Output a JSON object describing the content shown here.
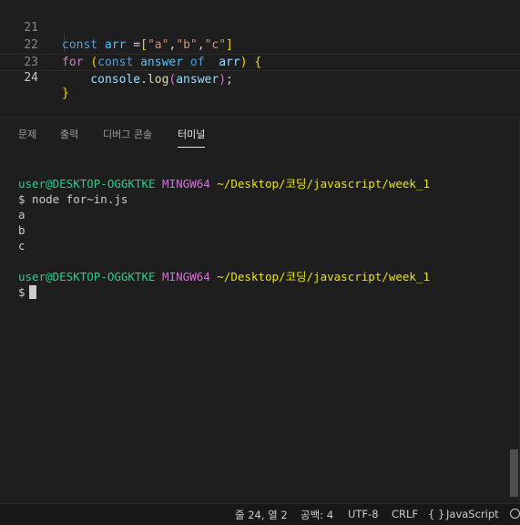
{
  "editor": {
    "lines": [
      {
        "num": "21",
        "tokens": [
          {
            "t": "const ",
            "c": "kw-b"
          },
          {
            "t": "arr",
            "c": "var"
          },
          {
            "t": " =",
            "c": "pl"
          },
          {
            "t": "[",
            "c": "br1"
          },
          {
            "t": "\"a\"",
            "c": "str"
          },
          {
            "t": ",",
            "c": "pl"
          },
          {
            "t": "\"b\"",
            "c": "str"
          },
          {
            "t": ",",
            "c": "pl"
          },
          {
            "t": "\"c\"",
            "c": "str"
          },
          {
            "t": "]",
            "c": "br1"
          }
        ]
      },
      {
        "num": "22",
        "tokens": [
          {
            "t": "for",
            "c": "kw-p"
          },
          {
            "t": " ",
            "c": "pl"
          },
          {
            "t": "(",
            "c": "br1"
          },
          {
            "t": "const ",
            "c": "kw-b"
          },
          {
            "t": "answer",
            "c": "var"
          },
          {
            "t": " of ",
            "c": "kw-b"
          },
          {
            "t": " arr",
            "c": "prm"
          },
          {
            "t": ")",
            "c": "br1"
          },
          {
            "t": " ",
            "c": "pl"
          },
          {
            "t": "{",
            "c": "br1"
          }
        ]
      },
      {
        "num": "23",
        "tokens": [
          {
            "t": "    console",
            "c": "prm"
          },
          {
            "t": ".",
            "c": "pl"
          },
          {
            "t": "log",
            "c": "fn"
          },
          {
            "t": "(",
            "c": "br2"
          },
          {
            "t": "answer",
            "c": "prm"
          },
          {
            "t": ")",
            "c": "br2"
          },
          {
            "t": ";",
            "c": "pl"
          }
        ]
      },
      {
        "num": "24",
        "tokens": [
          {
            "t": "}",
            "c": "br1"
          }
        ]
      }
    ]
  },
  "panel": {
    "tabs": [
      {
        "label": "문제"
      },
      {
        "label": "출력"
      },
      {
        "label": "디버그 콘솔"
      },
      {
        "label": "터미널"
      }
    ],
    "active_tab": 3
  },
  "terminal": {
    "lines": [
      {
        "segs": [
          {
            "t": "user@DESKTOP-OGGKTKE",
            "c": "t-green"
          },
          {
            "t": " ",
            "c": ""
          },
          {
            "t": "MINGW64",
            "c": "t-mag"
          },
          {
            "t": " ",
            "c": ""
          },
          {
            "t": "~/Desktop/코딩/javascript/week_1",
            "c": "t-yel"
          }
        ]
      },
      {
        "segs": [
          {
            "t": "$ node for~in.js",
            "c": ""
          }
        ]
      },
      {
        "segs": [
          {
            "t": "a",
            "c": ""
          }
        ]
      },
      {
        "segs": [
          {
            "t": "b",
            "c": ""
          }
        ]
      },
      {
        "segs": [
          {
            "t": "c",
            "c": ""
          }
        ]
      },
      {
        "segs": [
          {
            "t": "",
            "c": ""
          }
        ]
      },
      {
        "segs": [
          {
            "t": "user@DESKTOP-OGGKTKE",
            "c": "t-green"
          },
          {
            "t": " ",
            "c": ""
          },
          {
            "t": "MINGW64",
            "c": "t-mag"
          },
          {
            "t": " ",
            "c": ""
          },
          {
            "t": "~/Desktop/코딩/javascript/week_1",
            "c": "t-yel"
          }
        ]
      },
      {
        "segs": [
          {
            "t": "$",
            "c": ""
          }
        ],
        "cursor": true
      }
    ]
  },
  "statusbar": {
    "position": "줄 24, 열 2",
    "spaces": "공백: 4",
    "encoding": "UTF-8",
    "eol": "CRLF",
    "braces": "{ }",
    "language": "JavaScript",
    "bell_icon": "bell-icon"
  }
}
